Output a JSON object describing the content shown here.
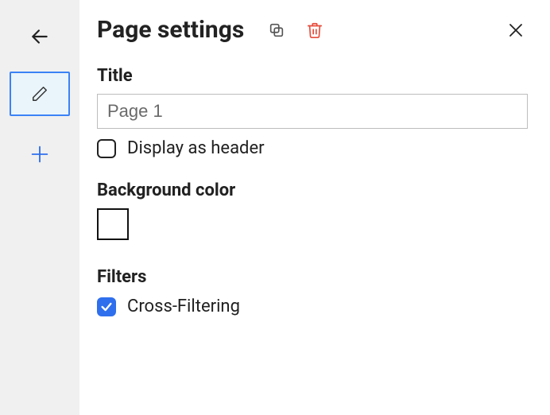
{
  "header": {
    "title": "Page settings"
  },
  "sections": {
    "title_label": "Title",
    "title_value": "Page 1",
    "display_as_header_label": "Display as header",
    "display_as_header_checked": false,
    "background_label": "Background color",
    "background_color": "#ffffff",
    "filters_label": "Filters",
    "cross_filtering_label": "Cross-Filtering",
    "cross_filtering_checked": true
  }
}
